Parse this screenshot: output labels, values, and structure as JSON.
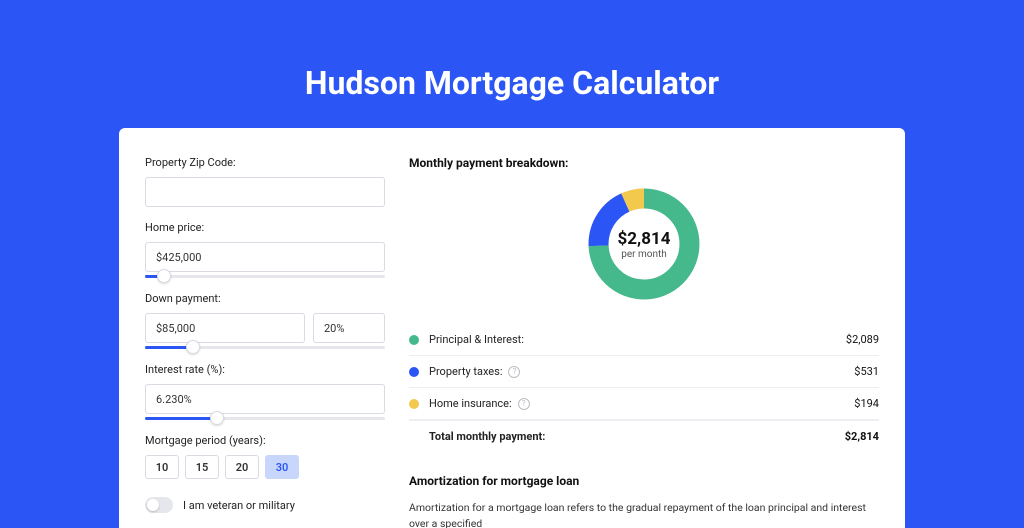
{
  "title": "Hudson Mortgage Calculator",
  "colors": {
    "pi": "#46b98c",
    "tax": "#2b56f5",
    "ins": "#f3c94d"
  },
  "form": {
    "zip_label": "Property Zip Code:",
    "zip_value": "",
    "price_label": "Home price:",
    "price_value": "$425,000",
    "price_slider_pct": 8,
    "dp_label": "Down payment:",
    "dp_amount": "$85,000",
    "dp_pct": "20%",
    "dp_slider_pct": 20,
    "rate_label": "Interest rate (%):",
    "rate_value": "6.230%",
    "rate_slider_pct": 30,
    "period_label": "Mortgage period (years):",
    "periods": [
      "10",
      "15",
      "20",
      "30"
    ],
    "period_selected": "30",
    "vet_label": "I am veteran or military"
  },
  "breakdown": {
    "heading": "Monthly payment breakdown:",
    "center_value": "$2,814",
    "center_sub": "per month",
    "rows": [
      {
        "key": "pi",
        "label": "Principal & Interest:",
        "value": "$2,089",
        "info": false
      },
      {
        "key": "tax",
        "label": "Property taxes:",
        "value": "$531",
        "info": true
      },
      {
        "key": "ins",
        "label": "Home insurance:",
        "value": "$194",
        "info": true
      }
    ],
    "total_label": "Total monthly payment:",
    "total_value": "$2,814"
  },
  "amort": {
    "heading": "Amortization for mortgage loan",
    "body": "Amortization for a mortgage loan refers to the gradual repayment of the loan principal and interest over a specified"
  },
  "chart_data": {
    "type": "pie",
    "title": "Monthly payment breakdown",
    "series": [
      {
        "name": "Principal & Interest",
        "value": 2089,
        "color": "#46b98c"
      },
      {
        "name": "Property taxes",
        "value": 531,
        "color": "#2b56f5"
      },
      {
        "name": "Home insurance",
        "value": 194,
        "color": "#f3c94d"
      }
    ],
    "total": 2814,
    "center_label": "$2,814 per month"
  }
}
